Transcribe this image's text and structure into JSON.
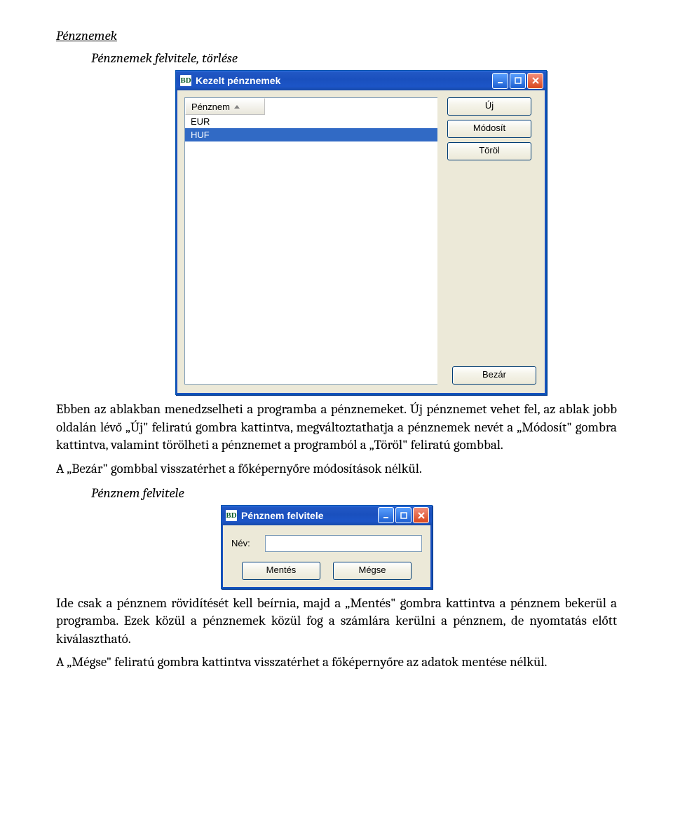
{
  "doc": {
    "h1": "Pénznemek",
    "h2a": "Pénznemek felvitele, törlése",
    "p1": "Ebben az ablakban menedzselheti a programba a pénznemeket. Új pénznemet vehet fel, az ablak jobb oldalán lévő „Új\" feliratú gombra kattintva, megváltoztathatja a pénznemek nevét a „Módosít\" gombra kattintva, valamint törölheti a pénznemet a programból a „Töröl\" feliratú gombbal.",
    "p1b": "A „Bezár\" gombbal visszatérhet a főképernyőre módosítások nélkül.",
    "h2b": "Pénznem felvitele",
    "p2": "Ide csak a pénznem rövidítését kell beírnia, majd a „Mentés\" gombra kattintva a pénznem bekerül a programba. Ezek közül a pénznemek közül fog a számlára kerülni a pénznem, de nyomtatás előtt kiválasztható.",
    "p3": "A „Mégse\" feliratú gombra kattintva visszatérhet a főképernyőre az adatok mentése nélkül."
  },
  "win1": {
    "appicon": "BD",
    "title": "Kezelt pénznemek",
    "colhead": "Pénznem",
    "rows": [
      "EUR",
      "HUF"
    ],
    "selected": 1,
    "btn_new": "Új",
    "btn_mod": "Módosít",
    "btn_del": "Töröl",
    "btn_close": "Bezár"
  },
  "win2": {
    "appicon": "BD",
    "title": "Pénznem felvitele",
    "label": "Név:",
    "value": "",
    "btn_save": "Mentés",
    "btn_cancel": "Mégse"
  }
}
